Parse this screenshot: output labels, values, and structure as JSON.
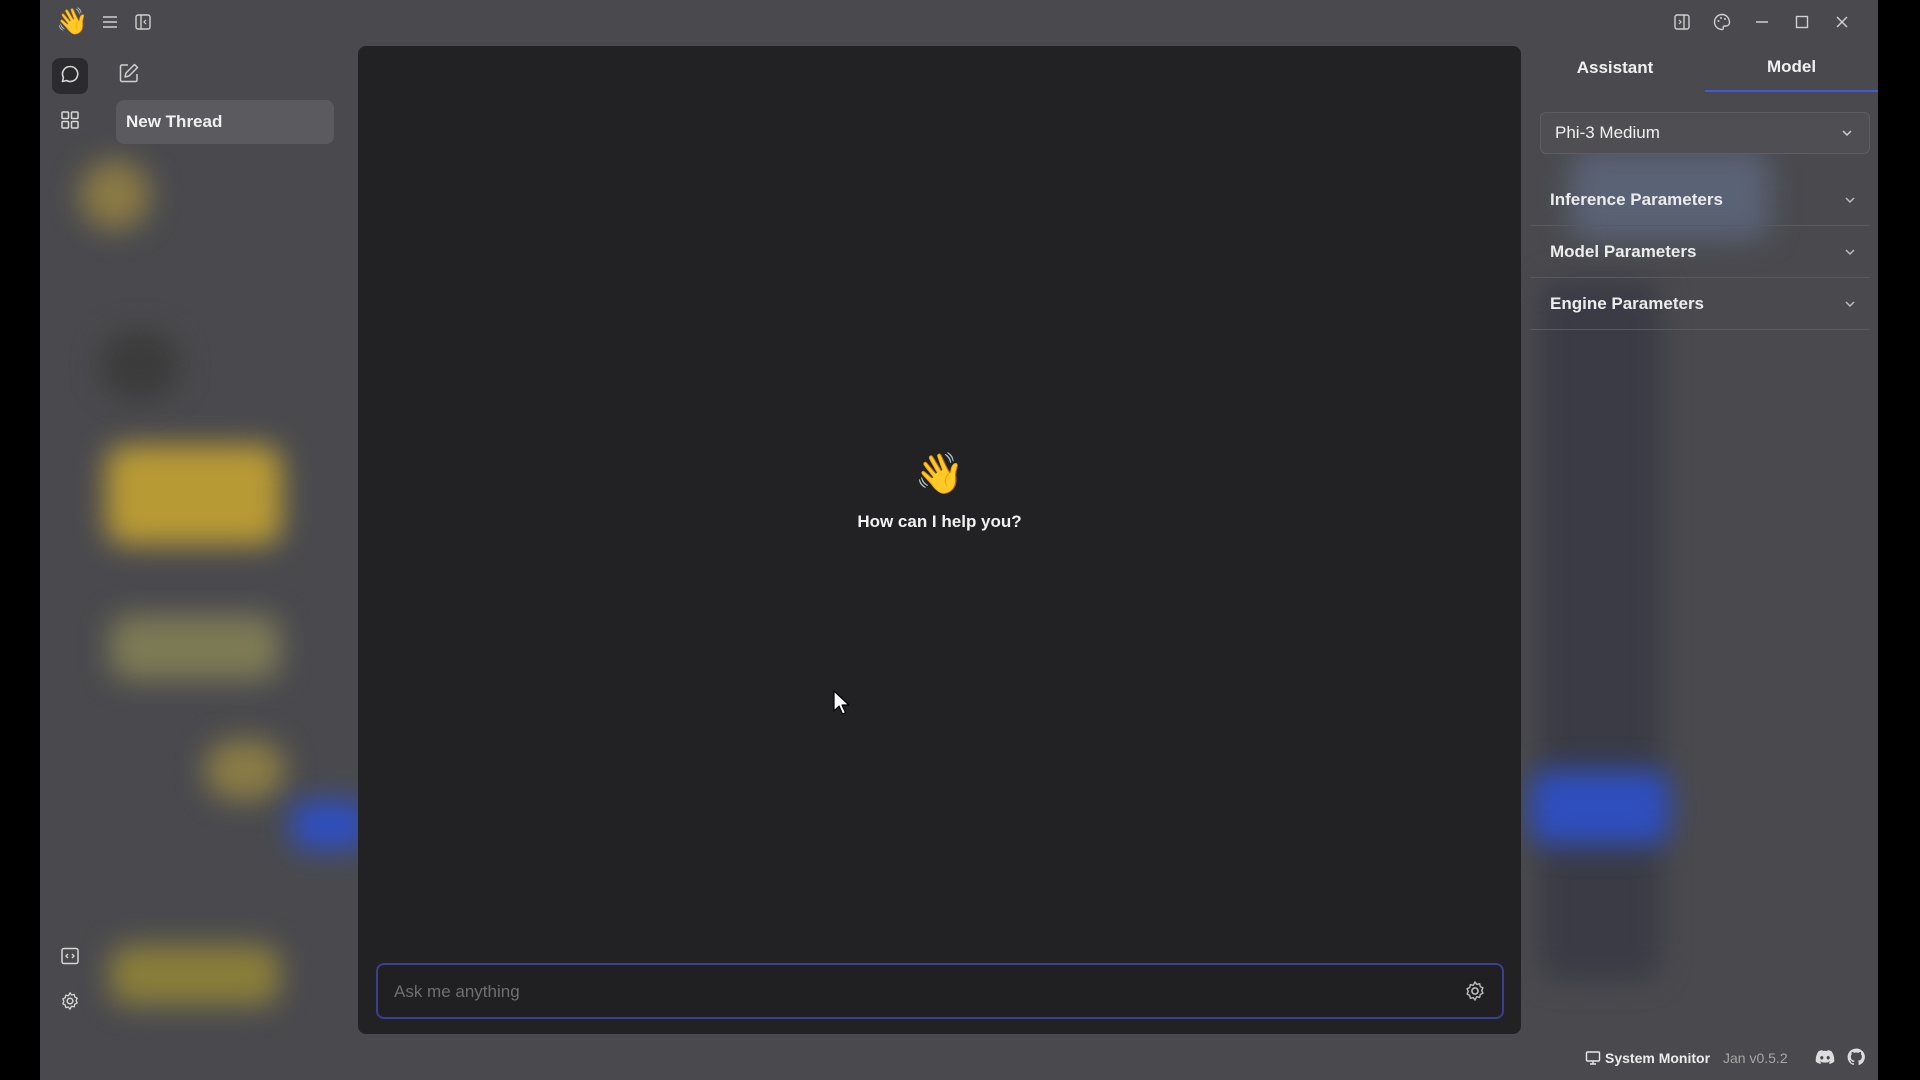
{
  "app": {
    "logo": "👋"
  },
  "sidebar": {
    "threads": [
      {
        "label": "New Thread"
      }
    ]
  },
  "chat": {
    "greeting_icon": "👋",
    "greeting": "How can I help you?",
    "input_placeholder": "Ask me anything"
  },
  "right_panel": {
    "tabs": [
      "Assistant",
      "Model"
    ],
    "active_tab": "Model",
    "model_selected": "Phi-3 Medium",
    "sections": [
      "Inference Parameters",
      "Model Parameters",
      "Engine Parameters"
    ]
  },
  "status_bar": {
    "system_monitor": "System Monitor",
    "version": "Jan v0.5.2"
  },
  "colors": {
    "accent": "#3c5bd6",
    "chat_bg": "#222224",
    "app_bg": "#4a4a4e"
  }
}
